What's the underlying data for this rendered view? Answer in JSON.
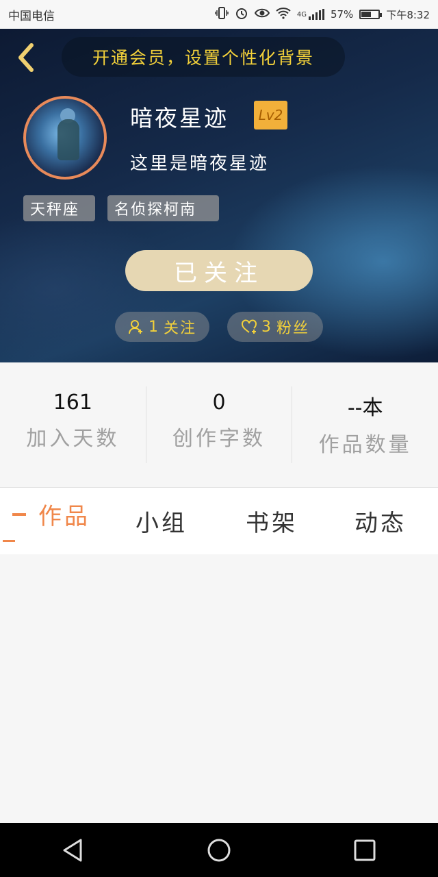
{
  "status_bar": {
    "carrier": "中国电信",
    "network": "4G",
    "battery": "57%",
    "battery_level": 0.57,
    "time": "下午8:32"
  },
  "header": {
    "vip_banner": "开通会员，设置个性化背景"
  },
  "profile": {
    "username": "暗夜星迹",
    "level": "Lv2",
    "bio": "这里是暗夜星迹",
    "tags": [
      "天秤座",
      "名侦探柯南"
    ],
    "follow_button": "已关注",
    "following": {
      "count": "1",
      "label": "关注"
    },
    "fans": {
      "count": "3",
      "label": "粉丝"
    }
  },
  "stats": [
    {
      "value": "161",
      "label": "加入天数"
    },
    {
      "value": "0",
      "label": "创作字数"
    },
    {
      "value": "--本",
      "label": "作品数量"
    }
  ],
  "tabs": [
    "作品",
    "小组",
    "书架",
    "动态"
  ],
  "colors": {
    "accent": "#f0874a",
    "gold": "#f3d13a",
    "follow_button": "#e6d7b3",
    "level_badge": "#f2b03a"
  },
  "icons": [
    "back-arrow-icon",
    "follow-person-icon",
    "fans-heart-icon",
    "nav-back-icon",
    "nav-home-icon",
    "nav-recents-icon"
  ]
}
